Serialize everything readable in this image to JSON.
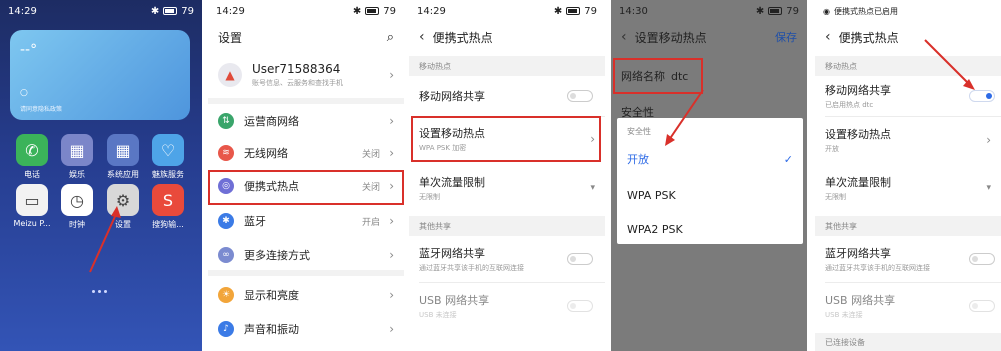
{
  "panel1": {
    "time": "14:29",
    "battery": "79",
    "widget_temp": "--°",
    "widget_sub": "○",
    "widget_note": "请同意隐私政策",
    "apps": [
      {
        "label": "电话",
        "icon": "phone-icon",
        "color": "#3bb35a"
      },
      {
        "label": "娱乐",
        "icon": "folder-icon",
        "color": "#7b86c9"
      },
      {
        "label": "系统应用",
        "icon": "folder-icon",
        "color": "#5a77c4"
      },
      {
        "label": "魅族服务",
        "icon": "heart-icon",
        "color": "#4ea4e8"
      },
      {
        "label": "Meizu P...",
        "icon": "wallet-icon",
        "color": "#f2f2f2"
      },
      {
        "label": "时钟",
        "icon": "clock-icon",
        "color": "#ffffff"
      },
      {
        "label": "设置",
        "icon": "gear-icon",
        "color": "#d8d8d8"
      },
      {
        "label": "搜狗输...",
        "icon": "sogou-icon",
        "color": "#e94a3b"
      }
    ]
  },
  "panel2": {
    "time": "14:29",
    "battery": "79",
    "title": "设置",
    "user_name": "User71588364",
    "user_desc": "账号信息、云服务和查找手机",
    "items": [
      {
        "label": "运营商网络",
        "value": "",
        "icon": "carrier-icon",
        "color": "#3aa56b"
      },
      {
        "label": "无线网络",
        "value": "关闭",
        "icon": "wifi-icon",
        "color": "#e8574a"
      },
      {
        "label": "便携式热点",
        "value": "关闭",
        "icon": "hotspot-icon",
        "color": "#6f6fd6"
      },
      {
        "label": "蓝牙",
        "value": "开启",
        "icon": "bluetooth-icon",
        "color": "#3b7be6"
      },
      {
        "label": "更多连接方式",
        "value": "",
        "icon": "link-icon",
        "color": "#7b8bd0"
      },
      {
        "label": "显示和亮度",
        "value": "",
        "icon": "display-icon",
        "color": "#f2a53a"
      },
      {
        "label": "声音和振动",
        "value": "",
        "icon": "sound-icon",
        "color": "#3b7be6"
      }
    ]
  },
  "panel3": {
    "time": "14:29",
    "battery": "79",
    "title": "便携式热点",
    "section1": "移动热点",
    "share_label": "移动网络共享",
    "setup_label": "设置移动热点",
    "setup_sub": "WPA PSK 加密",
    "limit_label": "单次流量限制",
    "limit_sub": "无限制",
    "section2": "其他共享",
    "bt_label": "蓝牙网络共享",
    "bt_sub": "通过蓝牙共享该手机的互联网连接",
    "usb_label": "USB 网络共享",
    "usb_sub": "USB 未连接"
  },
  "panel4": {
    "time": "14:30",
    "battery": "79",
    "title": "设置移动热点",
    "save": "保存",
    "net_name_label": "网络名称",
    "net_name_value": "dtc",
    "security_label": "安全性",
    "dialog_title": "安全性",
    "options": [
      "开放",
      "WPA PSK",
      "WPA2 PSK"
    ],
    "selected": "开放"
  },
  "panel5": {
    "status": "便携式热点已启用",
    "battery": "79",
    "title": "便携式热点",
    "section1": "移动热点",
    "share_label": "移动网络共享",
    "share_sub": "已启用热点 dtc",
    "setup_label": "设置移动热点",
    "setup_sub": "开放",
    "limit_label": "单次流量限制",
    "limit_sub": "无限制",
    "section2": "其他共享",
    "bt_label": "蓝牙网络共享",
    "bt_sub": "通过蓝牙共享该手机的互联网连接",
    "usb_label": "USB 网络共享",
    "usb_sub": "USB 未连接",
    "section3": "已连接设备"
  },
  "colors": {
    "highlight": "#d9302a",
    "accent": "#2e6be6"
  }
}
